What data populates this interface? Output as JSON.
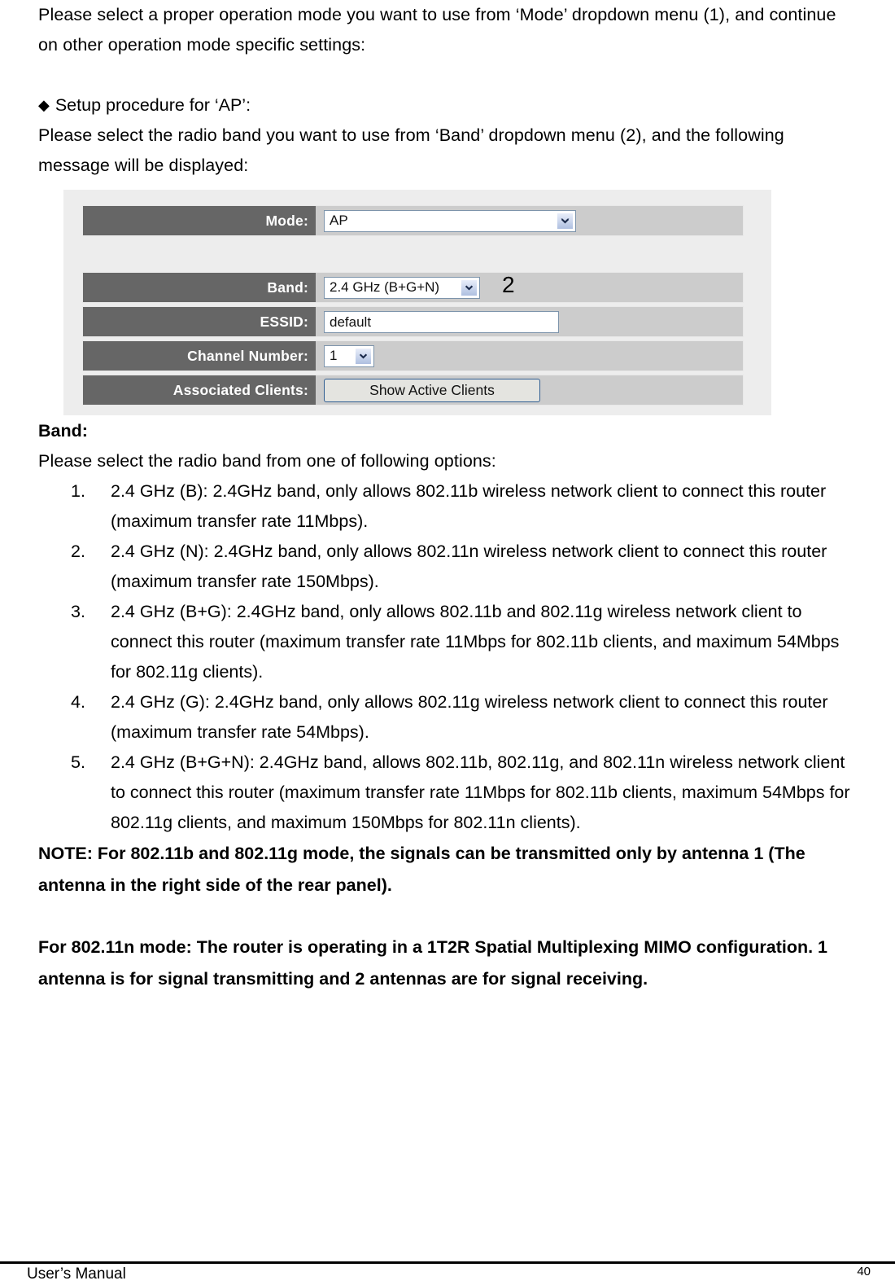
{
  "document": {
    "intro_paragraph": "Please select a proper operation mode you want to use from ‘Mode’ dropdown menu (1), and continue on other operation mode specific settings:",
    "bullet_symbol": "◆",
    "bullet_heading": "Setup procedure for ‘AP’:",
    "bullet_body": "Please select the radio band you want to use from ‘Band’ dropdown menu (2), and the following message will be displayed:",
    "band_heading": "Band:",
    "band_intro": "Please select the radio band from one of following options:",
    "band_options": [
      {
        "num": "1.",
        "text": "2.4 GHz (B): 2.4GHz band, only allows 802.11b wireless network client to connect this router (maximum transfer rate 11Mbps)."
      },
      {
        "num": "2.",
        "text": "2.4 GHz (N): 2.4GHz band, only allows 802.11n wireless network client to connect this router (maximum transfer rate 150Mbps)."
      },
      {
        "num": "3.",
        "text": "2.4 GHz (B+G): 2.4GHz band, only allows 802.11b and 802.11g wireless network client to connect this router (maximum transfer rate 11Mbps for 802.11b clients, and maximum 54Mbps for 802.11g clients)."
      },
      {
        "num": "4.",
        "text": "2.4 GHz (G): 2.4GHz band, only allows 802.11g wireless network client to connect this router (maximum transfer rate 54Mbps)."
      },
      {
        "num": "5.",
        "text": "2.4 GHz (B+G+N): 2.4GHz band, allows 802.11b, 802.11g, and 802.11n wireless network client to connect this router (maximum transfer rate 11Mbps for 802.11b clients, maximum 54Mbps for 802.11g clients, and maximum 150Mbps for 802.11n clients)."
      }
    ],
    "note_text": "NOTE: For 802.11b and 802.11g mode, the signals can be transmitted only by antenna 1 (The antenna in the right side of the rear panel).",
    "mimo_text": "For 802.11n mode: The router is operating in a 1T2R Spatial Multiplexing MIMO configuration. 1 antenna is for signal transmitting and 2 antennas are for signal receiving."
  },
  "screenshot_panel": {
    "callout_label": "2",
    "rows": [
      {
        "label": "Mode:",
        "value": "AP",
        "control": "select"
      },
      {
        "label": "Band:",
        "value": "2.4 GHz (B+G+N)",
        "control": "select"
      },
      {
        "label": "ESSID:",
        "value": "default",
        "control": "text"
      },
      {
        "label": "Channel Number:",
        "value": "1",
        "control": "select"
      },
      {
        "label": "Associated Clients:",
        "value": "Show Active Clients",
        "control": "button"
      }
    ],
    "colors": {
      "label_cell": "#666666",
      "row_cell": "#cccccc",
      "panel_background": "#ededed",
      "input_border": "#7d94ab",
      "button_border": "#2f5d92"
    }
  },
  "footer": {
    "left_label": "User’s Manual",
    "page_number": "40"
  }
}
